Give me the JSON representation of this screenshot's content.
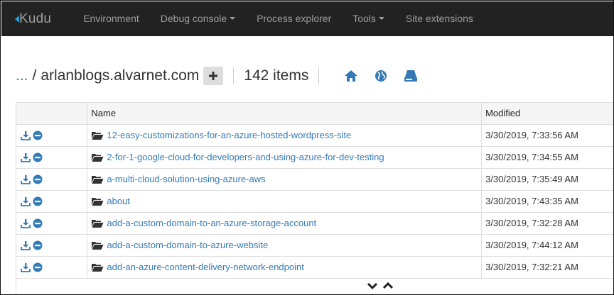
{
  "nav": {
    "brand": "Kudu",
    "items": [
      {
        "label": "Environment",
        "dropdown": false
      },
      {
        "label": "Debug console",
        "dropdown": true
      },
      {
        "label": "Process explorer",
        "dropdown": false
      },
      {
        "label": "Tools",
        "dropdown": true
      },
      {
        "label": "Site extensions",
        "dropdown": false
      }
    ]
  },
  "path": {
    "ellipsis": "...",
    "separator": "/",
    "current": "arlanblogs.alvarnet.com",
    "item_count": "142 items"
  },
  "toolbar_icons": [
    "home-icon",
    "globe-icon",
    "drive-icon"
  ],
  "table": {
    "headers": {
      "actions": "",
      "name": "Name",
      "modified": "Modified"
    },
    "rows": [
      {
        "name": "12-easy-customizations-for-an-azure-hosted-wordpress-site",
        "modified": "3/30/2019, 7:33:56 AM"
      },
      {
        "name": "2-for-1-google-cloud-for-developers-and-using-azure-for-dev-testing",
        "modified": "3/30/2019, 7:34:55 AM"
      },
      {
        "name": "a-multi-cloud-solution-using-azure-aws",
        "modified": "3/30/2019, 7:35:49 AM"
      },
      {
        "name": "about",
        "modified": "3/30/2019, 7:43:35 AM"
      },
      {
        "name": "add-a-custom-domain-to-an-azure-storage-account",
        "modified": "3/30/2019, 7:32:28 AM"
      },
      {
        "name": "add-a-custom-domain-to-azure-website",
        "modified": "3/30/2019, 7:44:12 AM"
      },
      {
        "name": "add-an-azure-content-delivery-network-endpoint",
        "modified": "3/30/2019, 7:32:21 AM"
      }
    ]
  },
  "colors": {
    "navbar_bg": "#222222",
    "nav_text": "#9d9d9d",
    "link": "#337ab7",
    "brand_accent": "#2a9fd6"
  }
}
